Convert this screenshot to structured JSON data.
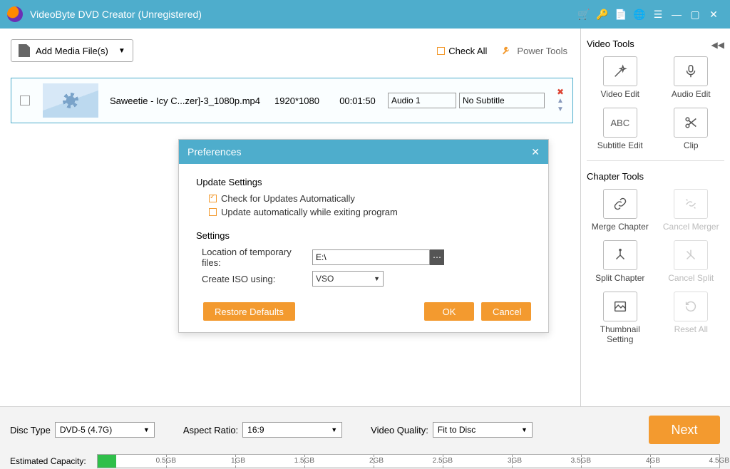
{
  "app": {
    "title": "VideoByte DVD Creator (Unregistered)"
  },
  "toolbar": {
    "add_media": "Add Media File(s)",
    "check_all": "Check All",
    "power_tools": "Power Tools"
  },
  "media": {
    "filename": "Saweetie - Icy C...zer]-3_1080p.mp4",
    "resolution": "1920*1080",
    "duration": "00:01:50",
    "audio": "Audio 1",
    "subtitle": "No Subtitle"
  },
  "preferences": {
    "title": "Preferences",
    "update_header": "Update Settings",
    "auto_check": "Check for Updates Automatically",
    "update_exiting": "Update automatically while exiting program",
    "settings_header": "Settings",
    "temp_files_label": "Location of temporary files:",
    "temp_files_value": "E:\\",
    "iso_label": "Create ISO using:",
    "iso_value": "VSO",
    "restore": "Restore Defaults",
    "ok": "OK",
    "cancel": "Cancel"
  },
  "sidebar": {
    "video_tools": "Video Tools",
    "video_edit": "Video Edit",
    "audio_edit": "Audio Edit",
    "subtitle_edit": "Subtitle Edit",
    "clip": "Clip",
    "chapter_tools": "Chapter Tools",
    "merge_chapter": "Merge Chapter",
    "cancel_merger": "Cancel Merger",
    "split_chapter": "Split Chapter",
    "cancel_split": "Cancel Split",
    "thumbnail_setting": "Thumbnail Setting",
    "reset_all": "Reset All"
  },
  "bottom": {
    "disc_type_label": "Disc Type",
    "disc_type": "DVD-5 (4.7G)",
    "aspect_label": "Aspect Ratio:",
    "aspect": "16:9",
    "quality_label": "Video Quality:",
    "quality": "Fit to Disc",
    "next": "Next",
    "capacity_label": "Estimated Capacity:",
    "ticks": [
      "0.5GB",
      "1GB",
      "1.5GB",
      "2GB",
      "2.5GB",
      "3GB",
      "3.5GB",
      "4GB",
      "4.5GB"
    ]
  }
}
